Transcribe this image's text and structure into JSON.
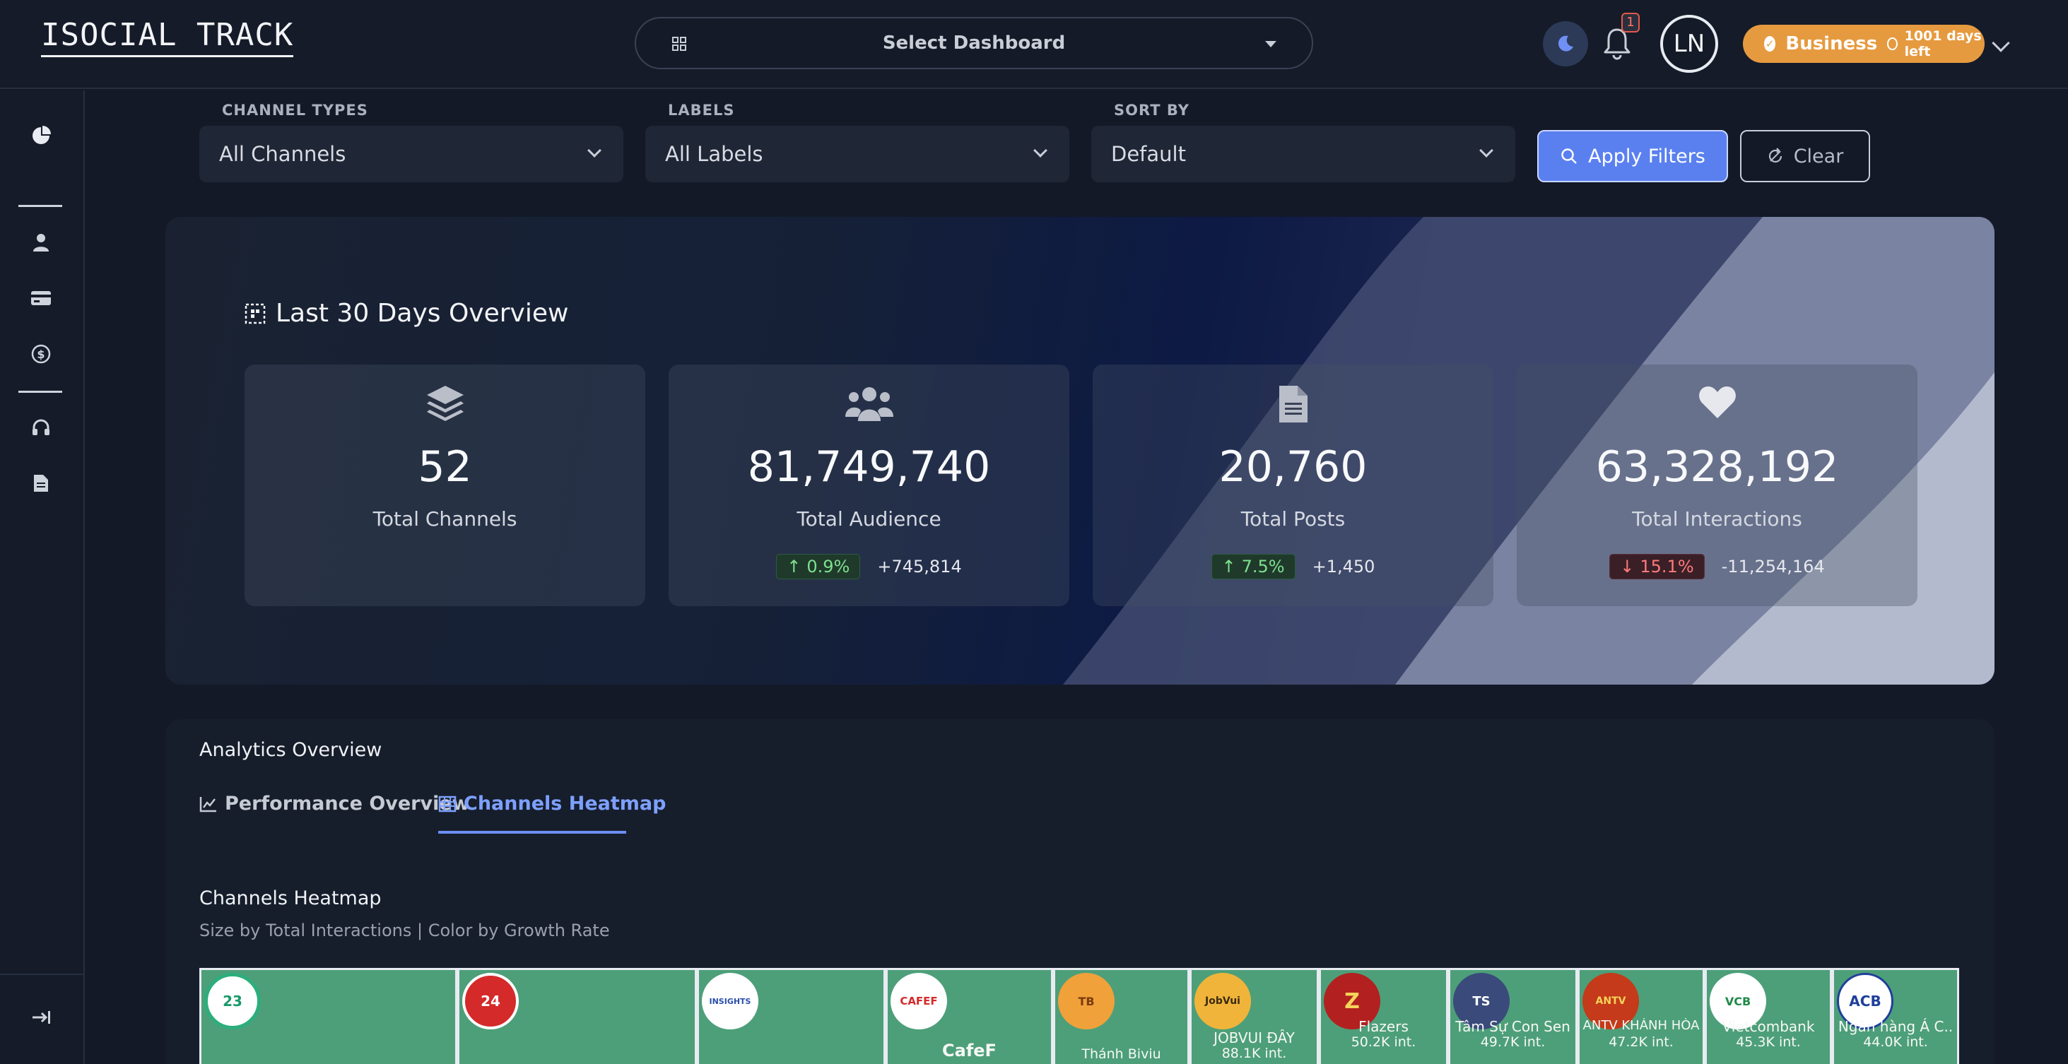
{
  "app": {
    "logo": "ISOCIAL TRACK"
  },
  "header": {
    "dashboard_select": "Select Dashboard",
    "notification_count": "1",
    "avatar_initials": "LN",
    "plan": {
      "name": "Business",
      "days_left": "1001 days left",
      "color": "#e69a3f"
    }
  },
  "sidebar": {
    "icons": [
      "pie-chart-icon",
      "user-icon",
      "credit-card-icon",
      "dollar-circle-icon",
      "headset-icon",
      "document-icon"
    ],
    "bottom_icon": "logout-icon"
  },
  "filters": {
    "channel_types": {
      "label": "CHANNEL TYPES",
      "value": "All Channels"
    },
    "labels": {
      "label": "LABELS",
      "value": "All Labels"
    },
    "sort_by": {
      "label": "SORT BY",
      "value": "Default"
    },
    "apply_label": "Apply Filters",
    "clear_label": "Clear"
  },
  "overview": {
    "title": "Last 30 Days Overview",
    "stats": [
      {
        "icon": "layers-icon",
        "value": "52",
        "label": "Total Channels",
        "change_pct": "",
        "change_abs": ""
      },
      {
        "icon": "users-icon",
        "value": "81,749,740",
        "label": "Total Audience",
        "change_pct": "0.9%",
        "change_abs": "+745,814",
        "direction": "up"
      },
      {
        "icon": "file-icon",
        "value": "20,760",
        "label": "Total Posts",
        "change_pct": "7.5%",
        "change_abs": "+1,450",
        "direction": "up"
      },
      {
        "icon": "heart-icon",
        "value": "63,328,192",
        "label": "Total Interactions",
        "change_pct": "15.1%",
        "change_abs": "-11,254,164",
        "direction": "down"
      }
    ]
  },
  "analytics": {
    "title": "Analytics Overview",
    "tabs": [
      {
        "label": "Performance Overview",
        "active": false
      },
      {
        "label": "Channels Heatmap",
        "active": true
      }
    ],
    "heatmap": {
      "title": "Channels Heatmap",
      "subtitle": "Size by Total Interactions | Color by Growth Rate",
      "cells": [
        {
          "logo": "23",
          "name": "",
          "value": ""
        },
        {
          "logo": "24",
          "name": "",
          "value": ""
        },
        {
          "logo": "INSIGHTS",
          "name": "",
          "value": ""
        },
        {
          "logo": "CAFEF",
          "name": "CafeF",
          "value": ""
        },
        {
          "logo": "TB",
          "name": "Thánh Biviu",
          "value": ""
        },
        {
          "logo": "JobVui",
          "name": "JOBVUI ĐÂY",
          "value": "88.1K int."
        },
        {
          "logo": "Z",
          "name": "Flazers",
          "value": "50.2K int."
        },
        {
          "logo": "TS",
          "name": "Tâm Sự Con Sen",
          "value": "49.7K int."
        },
        {
          "logo": "ANTV",
          "name": "ANTV KHÁNH HÒA",
          "value": "47.2K int."
        },
        {
          "logo": "VCB",
          "name": "Vietcombank",
          "value": "45.3K int."
        },
        {
          "logo": "ACB",
          "name": "Ngân hàng Á C..",
          "value": "44.0K int."
        }
      ]
    }
  }
}
